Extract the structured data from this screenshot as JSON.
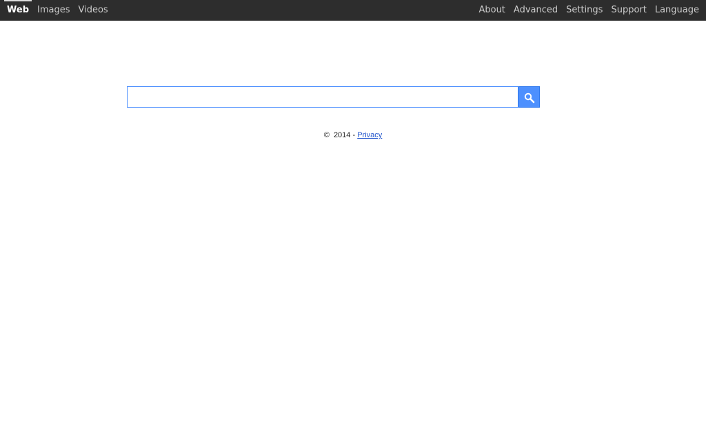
{
  "nav": {
    "left": [
      "Web",
      "Images",
      "Videos"
    ],
    "active": "Web",
    "right": [
      "About",
      "Advanced",
      "Settings",
      "Support",
      "Language"
    ]
  },
  "search": {
    "value": "",
    "placeholder": "",
    "button_icon": "search-icon"
  },
  "footer": {
    "copyright_symbol": "©",
    "year": "2014",
    "separator": "-",
    "privacy_label": "Privacy"
  },
  "colors": {
    "topbar": "#2d2d2d",
    "accent": "#4d90fe",
    "link": "#2255cc"
  }
}
